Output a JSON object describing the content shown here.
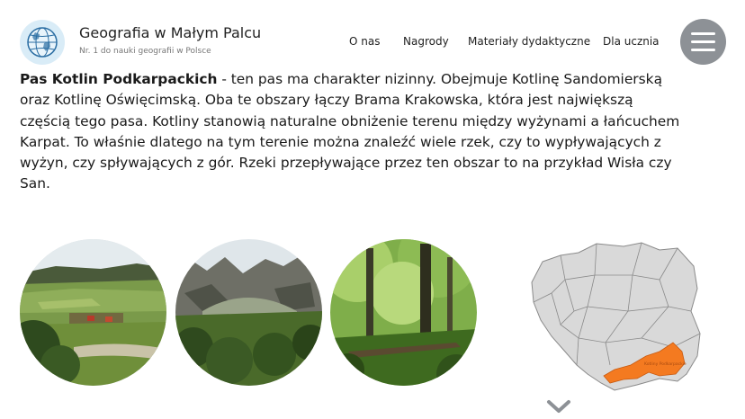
{
  "header": {
    "title": "Geografia w Małym Palcu",
    "subtitle": "Nr. 1 do nauki geografii w Polsce",
    "logo_icon": "globe-icon",
    "menu_icon": "hamburger-icon"
  },
  "nav": {
    "items": [
      {
        "label": "O nas"
      },
      {
        "label": "Nagrody"
      },
      {
        "label": "Materiały dydaktyczne"
      },
      {
        "label": "Dla ucznia"
      }
    ]
  },
  "article": {
    "bold_lead": "Pas Kotlin Podkarpackich",
    "body": " - ten pas ma charakter nizinny. Obejmuje Kotlinę Sandomierską oraz Kotlinę Oświęcimską. Oba te obszary łączy Brama Krakowska, która jest największą częścią tego pasa. Kotliny stanowią naturalne obniżenie terenu między wyżynami a łańcuchem Karpat. To właśnie dlatego na tym terenie można znaleźć wiele rzek, czy to wypływających z wyżyn, czy spływających z gór. Rzeki przepływające przez ten obszar to na przykład Wisła czy San."
  },
  "photos": [
    {
      "name": "photo-valley-village"
    },
    {
      "name": "photo-mountain-cirque"
    },
    {
      "name": "photo-forest"
    }
  ],
  "map": {
    "icon": "poland-map",
    "highlight_label": "Kotliny Podkarpackie",
    "highlight_color": "#f47a20",
    "land_color": "#d9d9d9"
  },
  "scroll_icon": "chevron-down-icon"
}
